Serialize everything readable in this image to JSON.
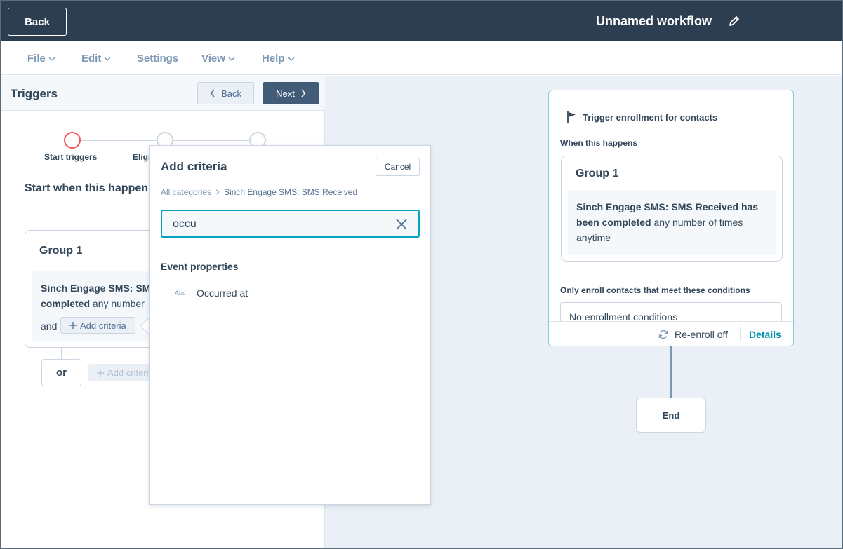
{
  "topbar": {
    "back_label": "Back",
    "workflow_title": "Unnamed workflow"
  },
  "menu": [
    {
      "label": "File",
      "has_dropdown": true
    },
    {
      "label": "Edit",
      "has_dropdown": true
    },
    {
      "label": "Settings",
      "has_dropdown": false
    },
    {
      "label": "View",
      "has_dropdown": true
    },
    {
      "label": "Help",
      "has_dropdown": true
    }
  ],
  "panel": {
    "title": "Triggers",
    "back_label": "Back",
    "next_label": "Next",
    "steps": [
      {
        "label": "Start triggers",
        "active": true
      },
      {
        "label": "Eligi",
        "active": false
      },
      {
        "label": "",
        "active": false
      }
    ],
    "start_when": "Start when this happen",
    "group_title": "Group 1",
    "criteria_bold": "Sinch Engage SMS: SM",
    "criteria_bold2": "completed",
    "criteria_rest": " any number",
    "and_label": "and",
    "add_criteria": "Add criteria",
    "or_label": "or",
    "add_criteria_disabled": "Add criteri"
  },
  "popover": {
    "title": "Add criteria",
    "cancel_label": "Cancel",
    "breadcrumb_root": "All categories",
    "breadcrumb_current": "Sinch Engage SMS: SMS Received",
    "search_value": "occu",
    "section_title": "Event properties",
    "results": [
      {
        "type_label": "Abc",
        "label": "Occurred at"
      }
    ]
  },
  "trigger_card": {
    "title": "Trigger enrollment for contacts",
    "when_label": "When this happens",
    "group_title": "Group 1",
    "criteria_bold": "Sinch Engage SMS: SMS Received has been completed",
    "criteria_rest": " any number of times anytime",
    "only_enroll_label": "Only enroll contacts that meet these conditions",
    "no_conditions": "No enrollment conditions",
    "reenroll_label": "Re-enroll off",
    "details_label": "Details"
  },
  "end_node": {
    "label": "End"
  },
  "colors": {
    "topbar": "#2d3e50",
    "accent_teal": "#00a4bd",
    "active_step": "#f2545b",
    "canvas": "#eaf0f6"
  }
}
